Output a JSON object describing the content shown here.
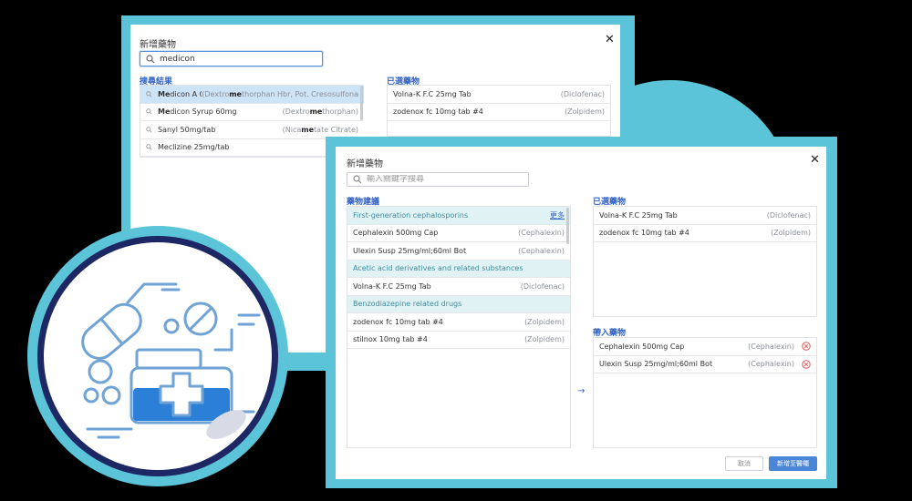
{
  "colors": {
    "teal": "#5cc4d8",
    "navy": "#1c2763",
    "accent": "#2f62c7",
    "highlight": "#cde3f7"
  },
  "back_dialog": {
    "title": "新增藥物",
    "search_value": "medicon",
    "results_heading": "搜尋結果",
    "results": [
      {
        "pre": "",
        "bold": "Me",
        "post": "dicon A Cap",
        "tag_pre": "(Dextro",
        "tag_bold": "me",
        "tag_post": "thorphan Hbr, Pot. Cresosulfona"
      },
      {
        "pre": "",
        "bold": "Me",
        "post": "dicon Syrup 60mg",
        "tag_pre": "(Dextro",
        "tag_bold": "me",
        "tag_post": "thorphan)"
      },
      {
        "pre": "Sanyl 50mg/tab",
        "bold": "",
        "post": "",
        "tag_pre": "(Nica",
        "tag_bold": "me",
        "tag_post": "tate Citrate)"
      },
      {
        "pre": "Meclizine 25mg/tab",
        "bold": "",
        "post": "",
        "tag_pre": "(",
        "tag_bold": "Me",
        "tag_post": ""
      }
    ],
    "selected_heading": "已選藥物",
    "selected": [
      {
        "name": "Volna-K F.C 25mg Tab",
        "tag": "(Diclofenac)"
      },
      {
        "name": "zodenox fc 10mg tab #4",
        "tag": "(Zolpidem)"
      }
    ]
  },
  "front_dialog": {
    "title": "新增藥物",
    "search_placeholder": "輸入關鍵字搜尋",
    "suggest_heading": "藥物建議",
    "more_label": "更多",
    "groups": [
      {
        "category": "First-generation cephalosporins",
        "items": [
          {
            "name": "Cephalexin 500mg Cap",
            "tag": "(Cephalexin)"
          },
          {
            "name": "Ulexin Susp 25mg/ml;60ml Bot",
            "tag": "(Cephalexin)"
          }
        ]
      },
      {
        "category": "Acetic acid derivatives and related substances",
        "items": [
          {
            "name": "Volna-K F.C 25mg Tab",
            "tag": "(Diclofenac)"
          }
        ]
      },
      {
        "category": "Benzodiazepine related drugs",
        "items": [
          {
            "name": "zodenox fc 10mg tab #4",
            "tag": "(Zolpidem)"
          },
          {
            "name": "stilnox 10mg tab #4",
            "tag": "(Zolpidem)"
          }
        ]
      }
    ],
    "selected_heading": "已選藥物",
    "selected": [
      {
        "name": "Volna-K F.C 25mg Tab",
        "tag": "(Diclofenac)"
      },
      {
        "name": "zodenox fc 10mg tab #4",
        "tag": "(Zolpidem)"
      }
    ],
    "import_heading": "帶入藥物",
    "imported": [
      {
        "name": "Cephalexin 500mg Cap",
        "tag": "(Cephalexin)"
      },
      {
        "name": "Ulexin Susp 25mg/ml;60ml Bot",
        "tag": "(Cephalexin)"
      }
    ],
    "arrow": "→",
    "cancel_label": "取消",
    "submit_label": "新增至醫囑"
  }
}
